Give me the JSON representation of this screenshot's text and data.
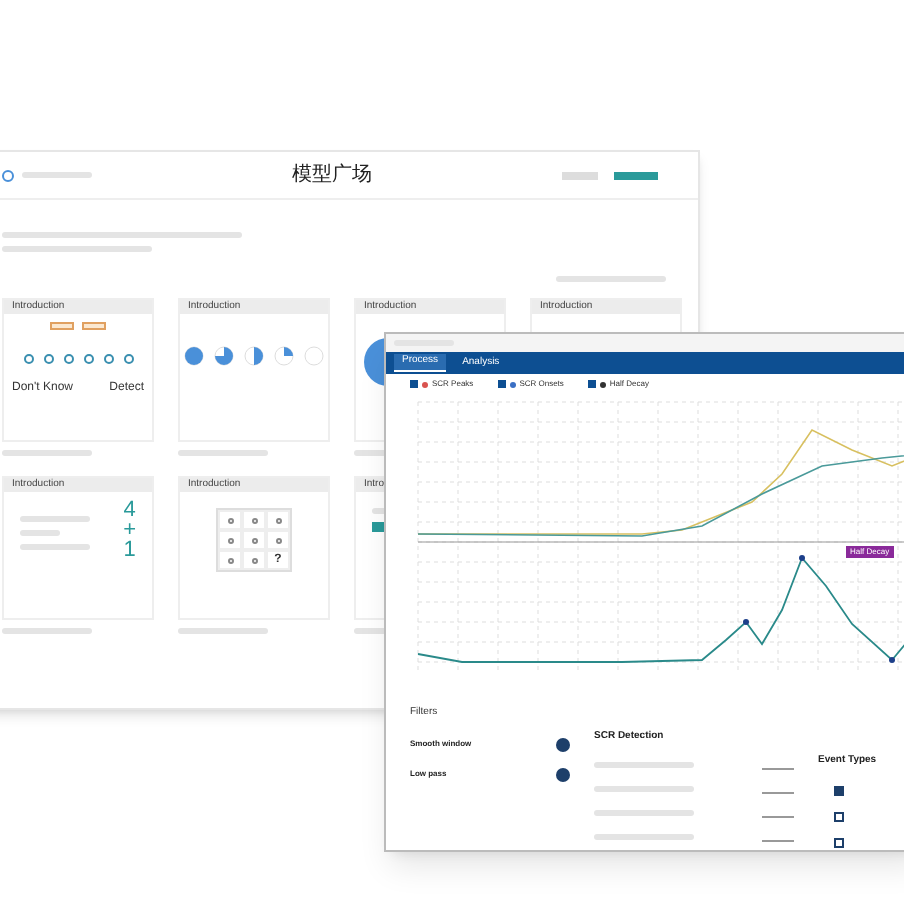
{
  "main_window": {
    "title": "模型广场",
    "cards": [
      {
        "header": "Introduction",
        "kind": "faces",
        "labels": [
          "Don't Know",
          "Detect"
        ]
      },
      {
        "header": "Introduction",
        "kind": "pies"
      },
      {
        "header": "Introduction",
        "kind": "circle"
      },
      {
        "header": "Introduction",
        "kind": "blank"
      },
      {
        "header": "Introduction",
        "kind": "equation",
        "symbols": [
          "4",
          "+",
          "1"
        ]
      },
      {
        "header": "Introduction",
        "kind": "grid",
        "symbol": "?"
      },
      {
        "header": "Intro",
        "kind": "form"
      }
    ]
  },
  "analysis_window": {
    "tabs": [
      {
        "label": "Process",
        "selected": true
      },
      {
        "label": "Analysis",
        "selected": false
      }
    ],
    "legend": [
      {
        "label": "SCR Peaks",
        "checked": true,
        "color": "#d9534f"
      },
      {
        "label": "SCR Onsets",
        "checked": true,
        "color": "#3a6fc4"
      },
      {
        "label": "Half Decay",
        "checked": true,
        "color": "#333333"
      }
    ],
    "badge": "Half Decay",
    "filters": {
      "title": "Filters",
      "items": [
        {
          "label": "Smooth window",
          "on": true
        },
        {
          "label": "Low pass",
          "on": true
        }
      ]
    },
    "detection": {
      "title": "SCR Detection"
    },
    "event": {
      "title": "Event Types",
      "types": [
        {
          "checked": true
        },
        {
          "checked": false
        },
        {
          "checked": false
        }
      ]
    }
  }
}
